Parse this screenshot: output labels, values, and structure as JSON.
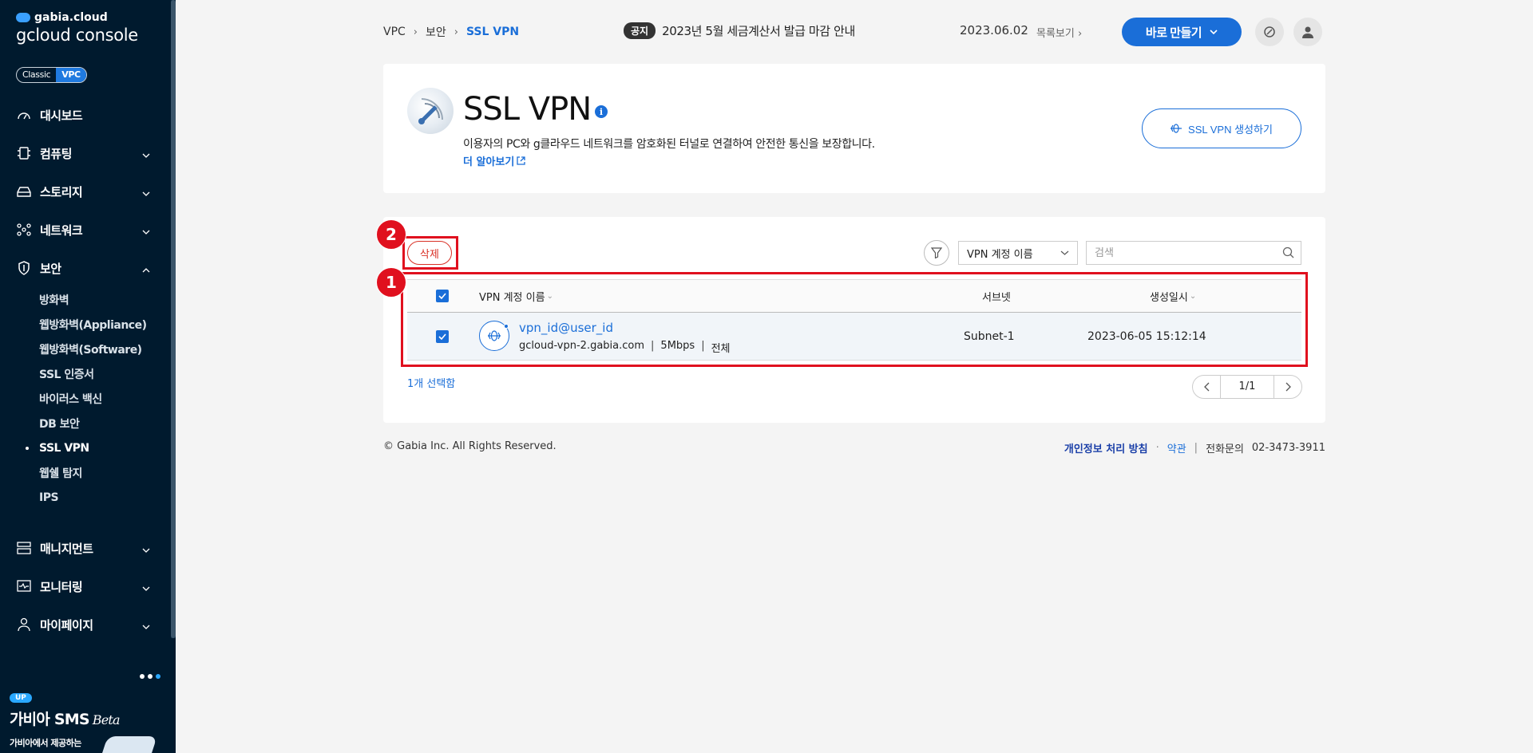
{
  "sidebar": {
    "brand": "gabia.cloud",
    "console": "gcloud console",
    "toggle": [
      "Classic",
      "VPC"
    ],
    "menu": [
      {
        "label": "대시보드",
        "icon": "dashboard-icon"
      },
      {
        "label": "컴퓨팅",
        "icon": "chip-icon"
      },
      {
        "label": "스토리지",
        "icon": "storage-icon"
      },
      {
        "label": "네트워크",
        "icon": "network-icon"
      },
      {
        "label": "보안",
        "icon": "shield-icon"
      },
      {
        "label": "매니지먼트",
        "icon": "management-icon"
      },
      {
        "label": "모니터링",
        "icon": "monitor-icon"
      },
      {
        "label": "마이페이지",
        "icon": "user-icon"
      }
    ],
    "security_sub": [
      "방화벽",
      "웹방화벽(Appliance)",
      "웹방화벽(Software)",
      "SSL 인증서",
      "바이러스 백신",
      "DB 보안",
      "SSL VPN",
      "웹쉘 탐지",
      "IPS"
    ],
    "promo": {
      "badge": "UP",
      "title": "가비아 SMS",
      "title_suffix": "Beta",
      "desc": "가비아에서 제공하는"
    }
  },
  "topbar": {
    "breadcrumb": [
      "VPC",
      "보안",
      "SSL VPN"
    ],
    "notice_tag": "공지",
    "notice_text": "2023년 5월 세금계산서 발급 마감 안내",
    "notice_date": "2023.06.02",
    "notice_list": "목록보기",
    "make_button": "바로 만들기"
  },
  "header": {
    "title": "SSL VPN",
    "description": "이용자의 PC와 g클라우드 네트워크를 암호화된 터널로 연결하여 안전한 통신을 보장합니다.",
    "more_link": "더 알아보기",
    "create_button": "SSL VPN 생성하기"
  },
  "list": {
    "delete_button": "삭제",
    "filter_select": "VPN 계정 이름",
    "search_placeholder": "검색",
    "columns": {
      "name": "VPN 계정 이름",
      "subnet": "서브넷",
      "created": "생성일시"
    },
    "rows": [
      {
        "name": "vpn_id@user_id",
        "host": "gcloud-vpn-2.gabia.com",
        "speed": "5Mbps",
        "scope": "전체",
        "subnet": "Subnet-1",
        "created": "2023-06-05 15:12:14"
      }
    ],
    "selected_count": "1개 선택함",
    "page": "1/1"
  },
  "footer": {
    "copyright": "© Gabia Inc. All Rights Reserved.",
    "privacy": "개인정보 처리 방침",
    "dot": "·",
    "terms": "약관",
    "bar": "|",
    "phone_label": "전화문의",
    "phone": "02-3473-3911"
  },
  "annotations": [
    "1",
    "2"
  ],
  "colors": {
    "accent": "#1a6ed8",
    "sidebar": "#001a2e",
    "annotation": "#e0101e"
  }
}
